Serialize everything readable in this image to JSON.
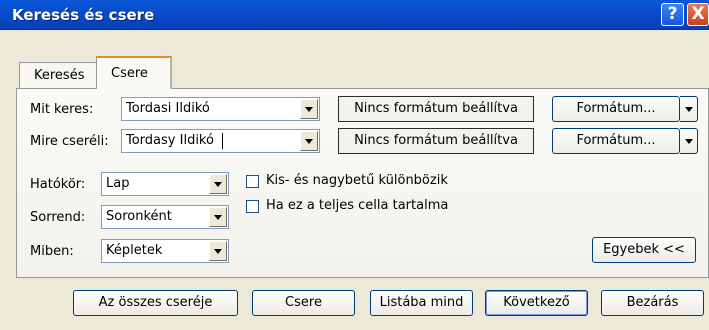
{
  "window": {
    "title": "Keresés és csere",
    "help_glyph": "?",
    "close_glyph": "X"
  },
  "tabs": [
    {
      "label": "Keresés"
    },
    {
      "label": "Csere"
    }
  ],
  "find": {
    "label": "Mit keres:",
    "value": "Tordasi Ildikó",
    "format_status": "Nincs formátum beállítva",
    "format_button": "Formátum..."
  },
  "replace": {
    "label": "Mire cseréli:",
    "value": "Tordasy Ildikó",
    "format_status": "Nincs formátum beállítva",
    "format_button": "Formátum..."
  },
  "options": {
    "scope": {
      "label": "Hatókör:",
      "value": "Lap"
    },
    "order": {
      "label": "Sorrend:",
      "value": "Soronként"
    },
    "look_in": {
      "label": "Miben:",
      "value": "Képletek"
    },
    "match_case": {
      "label": "Kis- és nagybetű különbözik",
      "checked": false
    },
    "entire_cell": {
      "label": "Ha ez a teljes cella tartalma",
      "checked": false
    },
    "fewer_button": "Egyebek <<"
  },
  "buttons": {
    "replace_all": "Az összes cseréje",
    "replace": "Csere",
    "find_all": "Listába mind",
    "find_next": "Következő",
    "close": "Bezárás"
  }
}
